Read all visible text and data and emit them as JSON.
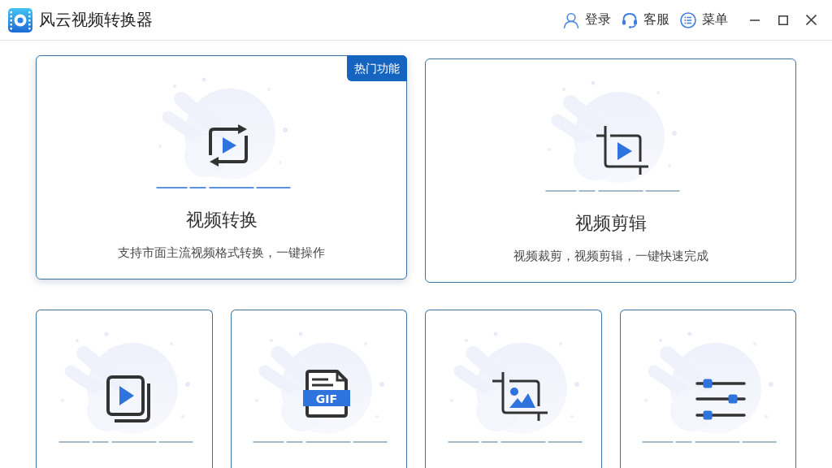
{
  "window": {
    "title": "风云视频转换器"
  },
  "header_actions": [
    {
      "label": "登录"
    },
    {
      "label": "客服"
    },
    {
      "label": "菜单"
    }
  ],
  "featured_cards": [
    {
      "title": "视频转换",
      "description": "支持市面主流视频格式转换，一键操作",
      "badge": "热门功能",
      "hovered": true
    },
    {
      "title": "视频剪辑",
      "description": "视频裁剪，视频剪辑，一键快速完成",
      "hovered": false
    }
  ],
  "tool_cards": [
    {
      "hovered": false
    },
    {
      "hovered": false,
      "icon_label": "GIF"
    },
    {
      "hovered": false
    },
    {
      "hovered": false
    }
  ]
}
